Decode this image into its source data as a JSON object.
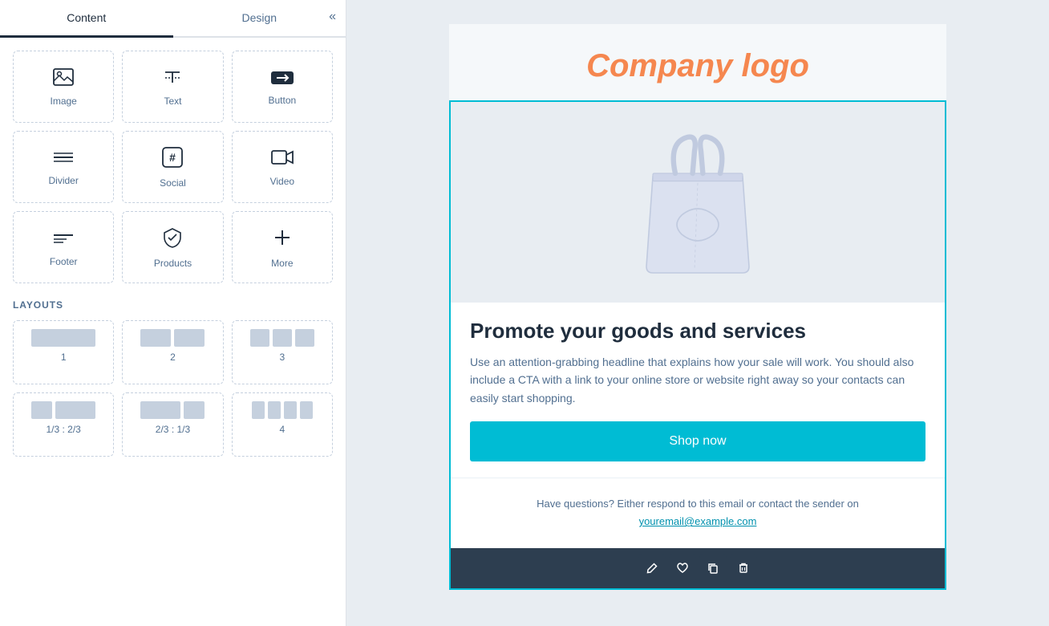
{
  "sidebar": {
    "collapse_icon": "«",
    "tabs": [
      {
        "id": "content",
        "label": "Content",
        "active": true
      },
      {
        "id": "design",
        "label": "Design",
        "active": false
      }
    ],
    "modules": [
      {
        "id": "image",
        "label": "Image",
        "icon": "🖼"
      },
      {
        "id": "text",
        "label": "Text",
        "icon": "📄"
      },
      {
        "id": "button",
        "label": "Button",
        "icon": "🔲"
      },
      {
        "id": "divider",
        "label": "Divider",
        "icon": "≡"
      },
      {
        "id": "social",
        "label": "Social",
        "icon": "#"
      },
      {
        "id": "video",
        "label": "Video",
        "icon": "▶"
      },
      {
        "id": "footer",
        "label": "Footer",
        "icon": "☰"
      },
      {
        "id": "products",
        "label": "Products",
        "icon": "📦"
      },
      {
        "id": "more",
        "label": "More",
        "icon": "+"
      }
    ],
    "layouts_title": "LAYOUTS",
    "layouts": [
      {
        "id": "1",
        "label": "1",
        "cols": [
          1
        ]
      },
      {
        "id": "2",
        "label": "2",
        "cols": [
          1,
          1
        ]
      },
      {
        "id": "3",
        "label": "3",
        "cols": [
          1,
          1,
          1
        ]
      },
      {
        "id": "1/3:2/3",
        "label": "1/3 : 2/3",
        "cols": [
          0.5,
          1
        ]
      },
      {
        "id": "2/3:1/3",
        "label": "2/3 : 1/3",
        "cols": [
          1,
          0.5
        ]
      },
      {
        "id": "4",
        "label": "4",
        "cols": [
          1,
          1,
          1,
          1
        ]
      }
    ]
  },
  "email": {
    "company_logo": "Company logo",
    "promo_heading": "Promote your goods and services",
    "promo_body": "Use an attention-grabbing headline that explains how your sale will work. You should also include a CTA with a link to your online store or website right away so your contacts can easily start shopping.",
    "shop_now_label": "Shop now",
    "footer_contact_text": "Have questions? Either respond to this email or contact the sender on",
    "footer_email": "youremail@example.com"
  },
  "toolbar": {
    "edit_icon": "✏",
    "heart_icon": "♥",
    "copy_icon": "⧉",
    "delete_icon": "🗑"
  },
  "colors": {
    "accent_orange": "#f5874f",
    "teal": "#00bcd4",
    "dark_navy": "#2d3e50",
    "sidebar_bg": "#ffffff",
    "main_bg": "#e8edf2",
    "text_dark": "#1f2d3d",
    "text_medium": "#516f90"
  }
}
